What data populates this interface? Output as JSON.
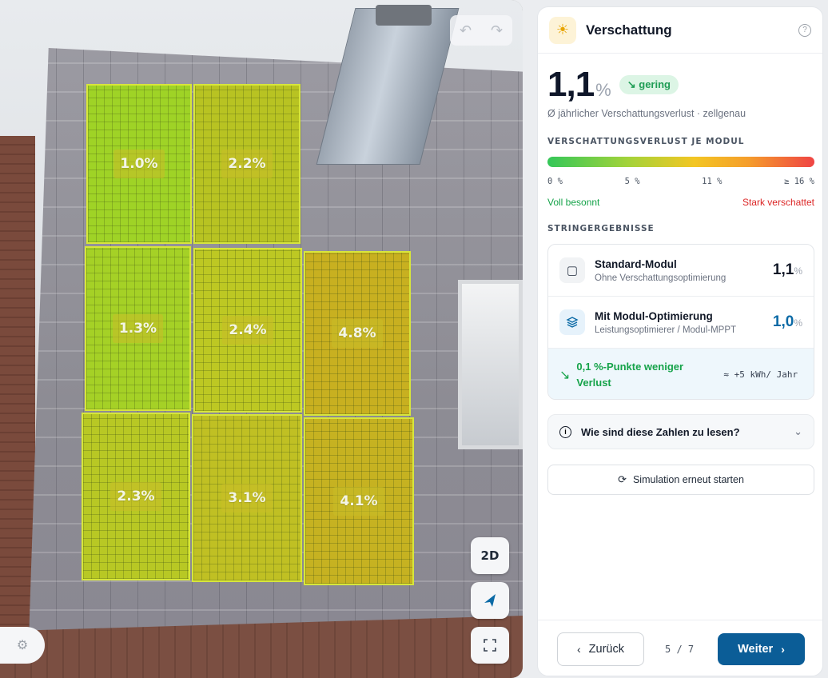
{
  "view3d": {
    "undo_icon": "undo-icon",
    "redo_icon": "redo-icon",
    "mode_label": "2D",
    "panels": [
      {
        "label": "1.0%",
        "shading_percent": 1.0,
        "color": "#9fd326"
      },
      {
        "label": "2.2%",
        "shading_percent": 2.2,
        "color": "#b8c322"
      },
      {
        "label": "1.3%",
        "shading_percent": 1.3,
        "color": "#a5d126"
      },
      {
        "label": "2.4%",
        "shading_percent": 2.4,
        "color": "#bdc823"
      },
      {
        "label": "4.8%",
        "shading_percent": 4.8,
        "color": "#c8b020"
      },
      {
        "label": "2.3%",
        "shading_percent": 2.3,
        "color": "#b8c824"
      },
      {
        "label": "3.1%",
        "shading_percent": 3.1,
        "color": "#c0c023"
      },
      {
        "label": "4.1%",
        "shading_percent": 4.1,
        "color": "#c6b221"
      }
    ]
  },
  "panel": {
    "title": "Verschattung",
    "value": "1,1",
    "unit": "%",
    "rating": "gering",
    "subtitle": "Ø jährlicher Verschattungsverlust · zellgenau",
    "module_section_label": "VERSCHATTUNGSVERLUST JE MODUL",
    "scale": [
      "0 %",
      "5 %",
      "11 %",
      "≥ 16 %"
    ],
    "legend_good": "Voll besonnt",
    "legend_bad": "Stark verschattet",
    "string_section_label": "STRINGERGEBNISSE",
    "rows": [
      {
        "title": "Standard-Modul",
        "subtitle": "Ohne Verschattungsoptimierung",
        "value": "1,1",
        "unit": "%"
      },
      {
        "title": "Mit Modul-Optimierung",
        "subtitle": "Leistungsoptimierer / Modul-MPPT",
        "value": "1,0",
        "unit": "%"
      }
    ],
    "saving_text": "0,1 %-Punkte weniger Verlust",
    "saving_extra": "≈ +5 kWh/ Jahr",
    "faq_label": "Wie sind diese Zahlen zu lesen?",
    "restart_label": "Simulation erneut starten",
    "back_label": "Zurück",
    "step": "5 / 7",
    "next_label": "Weiter"
  },
  "colors": {
    "accent": "#0b5d97",
    "good": "#16a34a",
    "bad": "#dc2626"
  }
}
